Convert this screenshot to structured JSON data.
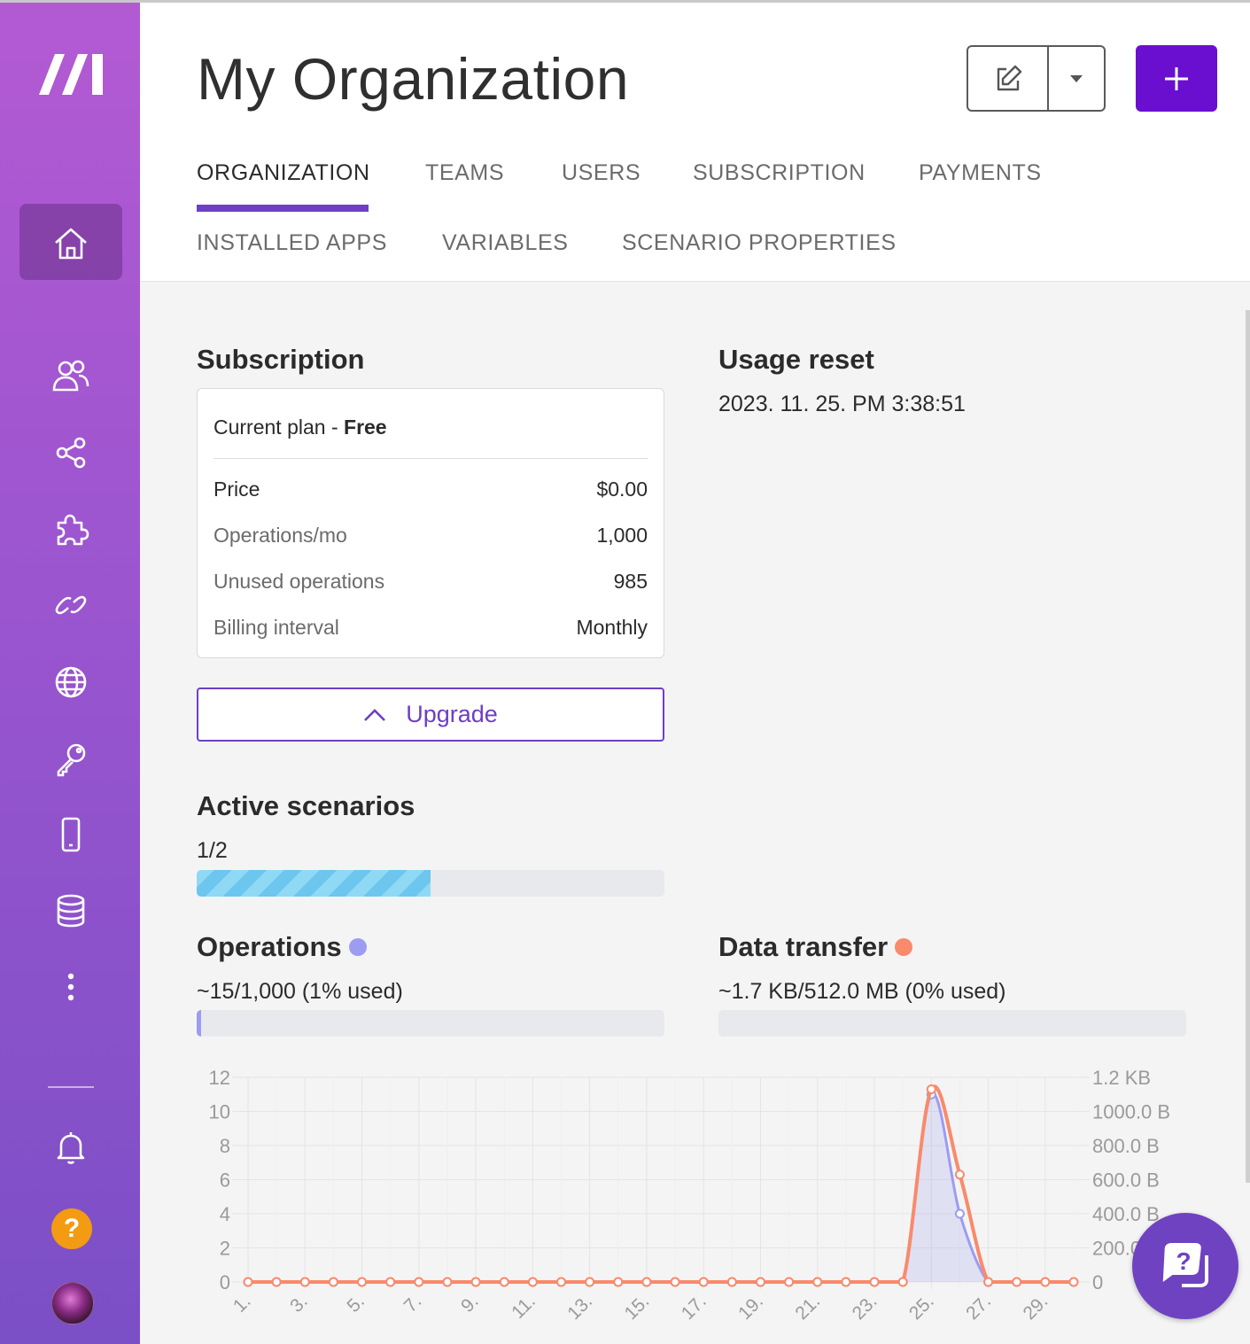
{
  "header": {
    "title": "My Organization",
    "tabs": [
      {
        "label": "ORGANIZATION",
        "active": true
      },
      {
        "label": "TEAMS"
      },
      {
        "label": "USERS"
      },
      {
        "label": "SUBSCRIPTION"
      },
      {
        "label": "PAYMENTS"
      },
      {
        "label": "INSTALLED APPS"
      },
      {
        "label": "VARIABLES"
      },
      {
        "label": "SCENARIO PROPERTIES"
      }
    ]
  },
  "sidebar": {
    "items": [
      "home-icon",
      "team-icon",
      "share-icon",
      "puzzle-icon",
      "link-icon",
      "globe-icon",
      "key-icon",
      "mobile-icon",
      "database-icon",
      "more-icon"
    ],
    "bottom": [
      "bell-icon",
      "help-icon",
      "avatar"
    ],
    "help_glyph": "?"
  },
  "subscription": {
    "title": "Subscription",
    "plan_label": "Current plan - ",
    "plan_value": "Free",
    "rows": [
      {
        "label": "Price",
        "value": "$0.00"
      },
      {
        "label": "Operations/mo",
        "value": "1,000"
      },
      {
        "label": "Unused operations",
        "value": "985"
      },
      {
        "label": "Billing interval",
        "value": "Monthly"
      }
    ],
    "upgrade_label": "Upgrade"
  },
  "usage_reset": {
    "title": "Usage reset",
    "value": "2023. 11. 25. PM 3:38:51"
  },
  "active_scenarios": {
    "title": "Active scenarios",
    "value": "1/2",
    "fraction": 0.5
  },
  "operations": {
    "title": "Operations",
    "value": "~15/1,000 (1% used)",
    "fraction": 0.01,
    "color": "#9c9cf2"
  },
  "data_transfer": {
    "title": "Data transfer",
    "value": "~1.7 KB/512.0 MB (0% used)",
    "fraction": 0.0,
    "color": "#f98a6b"
  },
  "chart_data": {
    "type": "line",
    "x": [
      1,
      2,
      3,
      4,
      5,
      6,
      7,
      8,
      9,
      10,
      11,
      12,
      13,
      14,
      15,
      16,
      17,
      18,
      19,
      20,
      21,
      22,
      23,
      24,
      25,
      26,
      27,
      28,
      29,
      30
    ],
    "x_tick_labels": [
      "1.",
      "3.",
      "5.",
      "7.",
      "9.",
      "11.",
      "13.",
      "15.",
      "17.",
      "19.",
      "21.",
      "23.",
      "25.",
      "27.",
      "29."
    ],
    "y_left_ticks": [
      "0",
      "2",
      "4",
      "6",
      "8",
      "10",
      "12"
    ],
    "y_right_ticks": [
      "0",
      "200.0 B",
      "400.0 B",
      "600.0 B",
      "800.0 B",
      "1000.0 B",
      "1.2 KB"
    ],
    "ylim_left": [
      0,
      12
    ],
    "ylim_right_bytes": [
      0,
      1200
    ],
    "series": [
      {
        "name": "Operations",
        "axis": "left",
        "color": "#9c9cf2",
        "fill": "rgba(156,156,242,0.22)",
        "values": [
          0,
          0,
          0,
          0,
          0,
          0,
          0,
          0,
          0,
          0,
          0,
          0,
          0,
          0,
          0,
          0,
          0,
          0,
          0,
          0,
          0,
          0,
          0,
          0,
          11,
          4,
          0,
          0,
          0,
          0
        ]
      },
      {
        "name": "Data transfer",
        "axis": "right",
        "color": "#f98a6b",
        "values": [
          0,
          0,
          0,
          0,
          0,
          0,
          0,
          0,
          0,
          0,
          0,
          0,
          0,
          0,
          0,
          0,
          0,
          0,
          0,
          0,
          0,
          0,
          0,
          0,
          1130,
          630,
          0,
          0,
          0,
          0
        ]
      }
    ],
    "grid": true
  }
}
